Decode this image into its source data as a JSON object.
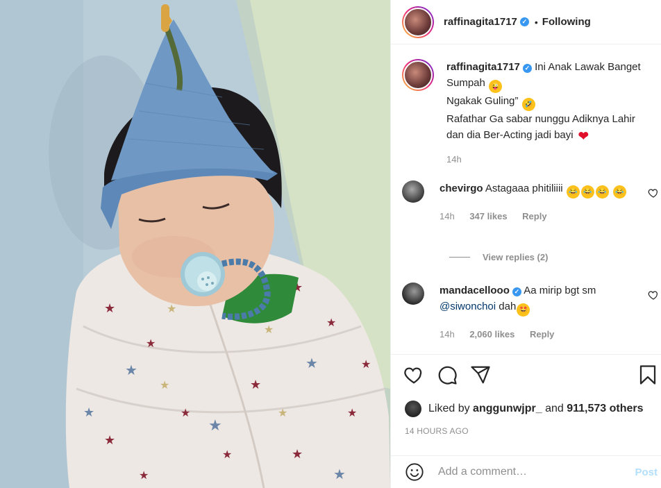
{
  "post": {
    "username": "raffinagita1717",
    "follow_state": "Following",
    "caption_lines": [
      "Ini Anak Lawak Banget",
      "Sumpah",
      "Ngakak Guling”",
      "Rafathar Ga sabar nunggu Adiknya Lahir",
      "dan dia Ber-Acting jadi bayi"
    ],
    "caption_time": "14h",
    "image_icon": "photo-of-child-in-blue-hat-with-pacifier-wrapped-in-star-blanket"
  },
  "comments": [
    {
      "username": "chevirgo",
      "verified": false,
      "text": "Astagaaa phitiliiii",
      "time": "14h",
      "likes": "347 likes",
      "reply_label": "Reply"
    },
    {
      "username": "mandacellooo",
      "verified": true,
      "text_before": "Aa mirip bgt sm",
      "mention": "@siwonchoi",
      "text_after": "dah",
      "time": "14h",
      "likes": "2,060 likes",
      "reply_label": "Reply"
    }
  ],
  "view_replies": "View replies (2)",
  "likes_summary": {
    "prefix": "Liked by",
    "user": "anggunwjpr_",
    "connector": "and",
    "others": "911,573 others"
  },
  "timestamp": "14 HOURS AGO",
  "add_comment": {
    "placeholder": "Add a comment…",
    "post_label": "Post"
  },
  "icons": [
    "heart-icon",
    "comment-icon",
    "share-icon",
    "bookmark-icon",
    "emoji-icon",
    "verified-icon"
  ],
  "colors": {
    "accent_link": "#00376b",
    "muted": "#8e8e8e",
    "verified": "#3897f0",
    "post_disabled": "#b2dffc"
  }
}
